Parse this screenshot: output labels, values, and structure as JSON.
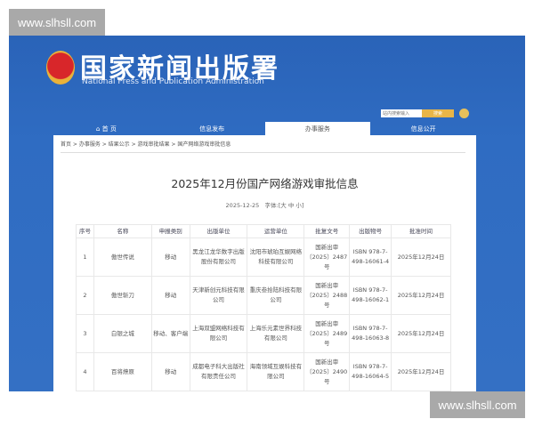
{
  "watermark": "www.slhsll.com",
  "header": {
    "logo_cn": "国家新闻出版署",
    "logo_en": "National  Press and Publication Administration",
    "search_placeholder": "站内搜索输入",
    "search_btn": "搜索",
    "colors": {
      "banner": "#2f6cc2",
      "accent": "#e8b548"
    }
  },
  "nav": [
    {
      "label": "首 页",
      "icon": "home-icon"
    },
    {
      "label": "信息发布"
    },
    {
      "label": "办事服务",
      "active": true
    },
    {
      "label": "信息公开"
    }
  ],
  "breadcrumb": "首页 > 办事服务 > 结果公示 > 游戏审批结果 > 国产网络游戏审批信息",
  "article": {
    "title": "2025年12月份国产网络游戏审批信息",
    "date": "2025-12-25",
    "font_label": "字体:[大 中 小]"
  },
  "table": {
    "headers": [
      "序号",
      "名称",
      "申报类别",
      "出版单位",
      "运营单位",
      "批复文号",
      "出版物号",
      "批准时间"
    ],
    "rows": [
      [
        "1",
        "傲世传说",
        "移动",
        "黑龙江龙华数字出版股份有限公司",
        "沈阳市琥珀互娱网络科技有限公司",
        "国新出审〔2025〕2487号",
        "ISBN 978-7-498-16061-4",
        "2025年12月24日"
      ],
      [
        "2",
        "傲世斩刀",
        "移动",
        "天津新创元科技有限公司",
        "重庆叁拾陆科技有限公司",
        "国新出审〔2025〕2488号",
        "ISBN 978-7-498-16062-1",
        "2025年12月24日"
      ],
      [
        "3",
        "白银之城",
        "移动、客户端",
        "上海双盟网络科技有限公司",
        "上海乐元素世界科技有限公司",
        "国新出审〔2025〕2489号",
        "ISBN 978-7-498-16063-8",
        "2025年12月24日"
      ],
      [
        "4",
        "百将燎原",
        "移动",
        "成都电子科大出版社有限责任公司",
        "海南领域互娱科技有限公司",
        "国新出审〔2025〕2490号",
        "ISBN 978-7-498-16064-5",
        "2025年12月24日"
      ]
    ]
  }
}
